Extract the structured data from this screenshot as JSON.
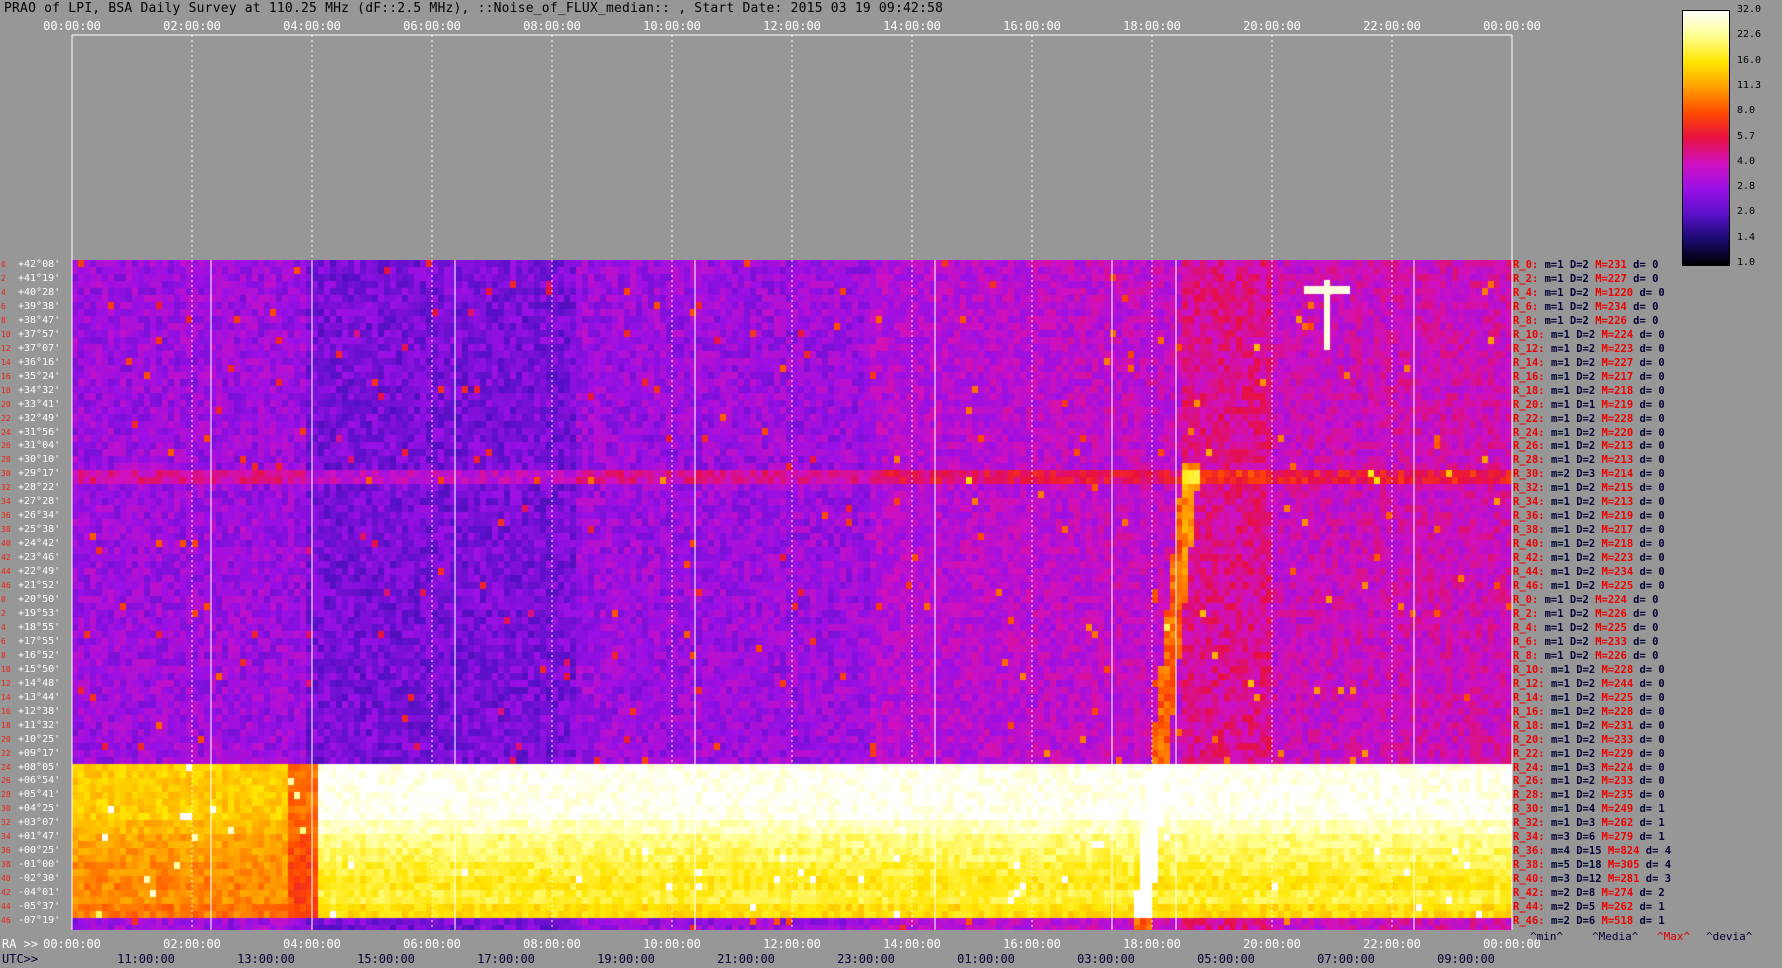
{
  "title": "PRAO of LPI, BSA Daily Survey at 110.25 MHz (dF::2.5 MHz), ::Noise_of_FLUX_median:: , Start Date: 2015 03 19 09:42:58",
  "top_axis_ticks": [
    "00:00:00",
    "02:00:00",
    "04:00:00",
    "06:00:00",
    "08:00:00",
    "10:00:00",
    "12:00:00",
    "14:00:00",
    "16:00:00",
    "18:00:00",
    "20:00:00",
    "22:00:00",
    "00:00:00"
  ],
  "ra_axis": {
    "prefix": "RA >>",
    "ticks": [
      "00:00:00",
      "02:00:00",
      "04:00:00",
      "06:00:00",
      "08:00:00",
      "10:00:00",
      "12:00:00",
      "14:00:00",
      "16:00:00",
      "18:00:00",
      "20:00:00",
      "22:00:00",
      "00:00:00"
    ]
  },
  "utc_axis": {
    "prefix": "UTC>>",
    "ticks": [
      "11:00:00",
      "13:00:00",
      "15:00:00",
      "17:00:00",
      "19:00:00",
      "21:00:00",
      "23:00:00",
      "01:00:00",
      "03:00:00",
      "05:00:00",
      "07:00:00",
      "09:00:00"
    ]
  },
  "stat_legend": [
    {
      "text": "^min^",
      "color": "#000033"
    },
    {
      "text": "^Media^",
      "color": "#000033"
    },
    {
      "text": "^Max^",
      "color": "#e00000"
    },
    {
      "text": "^devia^",
      "color": "#000033"
    }
  ],
  "colorbar": {
    "ticks": [
      "32.0",
      "22.6",
      "16.0",
      "11.3",
      "8.0",
      "5.7",
      "4.0",
      "2.8",
      "2.0",
      "1.4",
      "1.0"
    ],
    "colors": [
      "#000000",
      "#1a0a6e",
      "#5a10c8",
      "#9a10e6",
      "#d010c0",
      "#e81040",
      "#ff4a00",
      "#ffa000",
      "#ffe600",
      "#ffff90",
      "#ffffff"
    ]
  },
  "chart_data": {
    "type": "heatmap",
    "title": "PRAO of LPI, BSA Daily Survey at 110.25 MHz (dF::2.5 MHz), ::Noise_of_FLUX_median:: , Start Date: 2015 03 19 09:42:58",
    "x_axis": "RA (sidereal) 00:00:00 to 00:00:00, UTC 09:42:58 start",
    "colorbar_range": [
      1.0,
      32.0
    ],
    "colorbar_scale": "log2",
    "rows": [
      {
        "idx": "0",
        "dec": "+42°08'",
        "ra": "R_0:",
        "m": "m=1",
        "D": "D=2",
        "M": "M=231",
        "d": "d= 0"
      },
      {
        "idx": "2",
        "dec": "+41°19'",
        "ra": "R_2:",
        "m": "m=1",
        "D": "D=2",
        "M": "M=227",
        "d": "d= 0"
      },
      {
        "idx": "4",
        "dec": "+40°28'",
        "ra": "R_4:",
        "m": "m=1",
        "D": "D=2",
        "M": "M=1220",
        "d": "d= 0"
      },
      {
        "idx": "6",
        "dec": "+39°38'",
        "ra": "R_6:",
        "m": "m=1",
        "D": "D=2",
        "M": "M=234",
        "d": "d= 0"
      },
      {
        "idx": "8",
        "dec": "+38°47'",
        "ra": "R_8:",
        "m": "m=1",
        "D": "D=2",
        "M": "M=226",
        "d": "d= 0"
      },
      {
        "idx": "10",
        "dec": "+37°57'",
        "ra": "R_10:",
        "m": "m=1",
        "D": "D=2",
        "M": "M=224",
        "d": "d= 0"
      },
      {
        "idx": "12",
        "dec": "+37°07'",
        "ra": "R_12:",
        "m": "m=1",
        "D": "D=2",
        "M": "M=223",
        "d": "d= 0"
      },
      {
        "idx": "14",
        "dec": "+36°16'",
        "ra": "R_14:",
        "m": "m=1",
        "D": "D=2",
        "M": "M=227",
        "d": "d= 0"
      },
      {
        "idx": "16",
        "dec": "+35°24'",
        "ra": "R_16:",
        "m": "m=1",
        "D": "D=2",
        "M": "M=217",
        "d": "d= 0"
      },
      {
        "idx": "18",
        "dec": "+34°32'",
        "ra": "R_18:",
        "m": "m=1",
        "D": "D=2",
        "M": "M=218",
        "d": "d= 0"
      },
      {
        "idx": "20",
        "dec": "+33°41'",
        "ra": "R_20:",
        "m": "m=1",
        "D": "D=1",
        "M": "M=219",
        "d": "d= 0"
      },
      {
        "idx": "22",
        "dec": "+32°49'",
        "ra": "R_22:",
        "m": "m=1",
        "D": "D=2",
        "M": "M=228",
        "d": "d= 0"
      },
      {
        "idx": "24",
        "dec": "+31°56'",
        "ra": "R_24:",
        "m": "m=1",
        "D": "D=2",
        "M": "M=220",
        "d": "d= 0"
      },
      {
        "idx": "26",
        "dec": "+31°04'",
        "ra": "R_26:",
        "m": "m=1",
        "D": "D=2",
        "M": "M=213",
        "d": "d= 0"
      },
      {
        "idx": "28",
        "dec": "+30°10'",
        "ra": "R_28:",
        "m": "m=1",
        "D": "D=2",
        "M": "M=213",
        "d": "d= 0"
      },
      {
        "idx": "30",
        "dec": "+29°17'",
        "ra": "R_30:",
        "m": "m=2",
        "D": "D=3",
        "M": "M=214",
        "d": "d= 0"
      },
      {
        "idx": "32",
        "dec": "+28°22'",
        "ra": "R_32:",
        "m": "m=1",
        "D": "D=2",
        "M": "M=215",
        "d": "d= 0"
      },
      {
        "idx": "34",
        "dec": "+27°28'",
        "ra": "R_34:",
        "m": "m=1",
        "D": "D=2",
        "M": "M=213",
        "d": "d= 0"
      },
      {
        "idx": "36",
        "dec": "+26°34'",
        "ra": "R_36:",
        "m": "m=1",
        "D": "D=2",
        "M": "M=219",
        "d": "d= 0"
      },
      {
        "idx": "38",
        "dec": "+25°38'",
        "ra": "R_38:",
        "m": "m=1",
        "D": "D=2",
        "M": "M=217",
        "d": "d= 0"
      },
      {
        "idx": "40",
        "dec": "+24°42'",
        "ra": "R_40:",
        "m": "m=1",
        "D": "D=2",
        "M": "M=218",
        "d": "d= 0"
      },
      {
        "idx": "42",
        "dec": "+23°46'",
        "ra": "R_42:",
        "m": "m=1",
        "D": "D=2",
        "M": "M=223",
        "d": "d= 0"
      },
      {
        "idx": "44",
        "dec": "+22°49'",
        "ra": "R_44:",
        "m": "m=1",
        "D": "D=2",
        "M": "M=234",
        "d": "d= 0"
      },
      {
        "idx": "46",
        "dec": "+21°52'",
        "ra": "R_46:",
        "m": "m=1",
        "D": "D=2",
        "M": "M=225",
        "d": "d= 0"
      },
      {
        "idx": "0",
        "dec": "+20°50'",
        "ra": "R_0:",
        "m": "m=1",
        "D": "D=2",
        "M": "M=224",
        "d": "d= 0"
      },
      {
        "idx": "2",
        "dec": "+19°53'",
        "ra": "R_2:",
        "m": "m=1",
        "D": "D=2",
        "M": "M=226",
        "d": "d= 0"
      },
      {
        "idx": "4",
        "dec": "+18°55'",
        "ra": "R_4:",
        "m": "m=1",
        "D": "D=2",
        "M": "M=225",
        "d": "d= 0"
      },
      {
        "idx": "6",
        "dec": "+17°55'",
        "ra": "R_6:",
        "m": "m=1",
        "D": "D=2",
        "M": "M=233",
        "d": "d= 0"
      },
      {
        "idx": "8",
        "dec": "+16°52'",
        "ra": "R_8:",
        "m": "m=1",
        "D": "D=2",
        "M": "M=226",
        "d": "d= 0"
      },
      {
        "idx": "10",
        "dec": "+15°50'",
        "ra": "R_10:",
        "m": "m=1",
        "D": "D=2",
        "M": "M=228",
        "d": "d= 0"
      },
      {
        "idx": "12",
        "dec": "+14°48'",
        "ra": "R_12:",
        "m": "m=1",
        "D": "D=2",
        "M": "M=244",
        "d": "d= 0"
      },
      {
        "idx": "14",
        "dec": "+13°44'",
        "ra": "R_14:",
        "m": "m=1",
        "D": "D=2",
        "M": "M=225",
        "d": "d= 0"
      },
      {
        "idx": "16",
        "dec": "+12°38'",
        "ra": "R_16:",
        "m": "m=1",
        "D": "D=2",
        "M": "M=228",
        "d": "d= 0"
      },
      {
        "idx": "18",
        "dec": "+11°32'",
        "ra": "R_18:",
        "m": "m=1",
        "D": "D=2",
        "M": "M=231",
        "d": "d= 0"
      },
      {
        "idx": "20",
        "dec": "+10°25'",
        "ra": "R_20:",
        "m": "m=1",
        "D": "D=2",
        "M": "M=233",
        "d": "d= 0"
      },
      {
        "idx": "22",
        "dec": "+09°17'",
        "ra": "R_22:",
        "m": "m=1",
        "D": "D=2",
        "M": "M=229",
        "d": "d= 0"
      },
      {
        "idx": "24",
        "dec": "+08°05'",
        "ra": "R_24:",
        "m": "m=1",
        "D": "D=3",
        "M": "M=224",
        "d": "d= 0"
      },
      {
        "idx": "26",
        "dec": "+06°54'",
        "ra": "R_26:",
        "m": "m=1",
        "D": "D=2",
        "M": "M=233",
        "d": "d= 0"
      },
      {
        "idx": "28",
        "dec": "+05°41'",
        "ra": "R_28:",
        "m": "m=1",
        "D": "D=2",
        "M": "M=235",
        "d": "d= 0"
      },
      {
        "idx": "30",
        "dec": "+04°25'",
        "ra": "R_30:",
        "m": "m=1",
        "D": "D=4",
        "M": "M=249",
        "d": "d= 1"
      },
      {
        "idx": "32",
        "dec": "+03°07'",
        "ra": "R_32:",
        "m": "m=1",
        "D": "D=3",
        "M": "M=262",
        "d": "d= 1"
      },
      {
        "idx": "34",
        "dec": "+01°47'",
        "ra": "R_34:",
        "m": "m=3",
        "D": "D=6",
        "M": "M=279",
        "d": "d= 1"
      },
      {
        "idx": "36",
        "dec": "+00°25'",
        "ra": "R_36:",
        "m": "m=4",
        "D": "D=15",
        "M": "M=824",
        "d": "d= 4"
      },
      {
        "idx": "38",
        "dec": "-01°00'",
        "ra": "R_38:",
        "m": "m=5",
        "D": "D=18",
        "M": "M=305",
        "d": "d= 4"
      },
      {
        "idx": "40",
        "dec": "-02°30'",
        "ra": "R_40:",
        "m": "m=3",
        "D": "D=12",
        "M": "M=281",
        "d": "d= 3"
      },
      {
        "idx": "42",
        "dec": "-04°01'",
        "ra": "R_42:",
        "m": "m=2",
        "D": "D=8",
        "M": "M=274",
        "d": "d= 2"
      },
      {
        "idx": "44",
        "dec": "-05°37'",
        "ra": "R_44:",
        "m": "m=2",
        "D": "D=5",
        "M": "M=262",
        "d": "d= 1"
      },
      {
        "idx": "46",
        "dec": "-07°19'",
        "ra": "R_46:",
        "m": "m=2",
        "D": "D=6",
        "M": "M=518",
        "d": "d= 1"
      }
    ]
  }
}
